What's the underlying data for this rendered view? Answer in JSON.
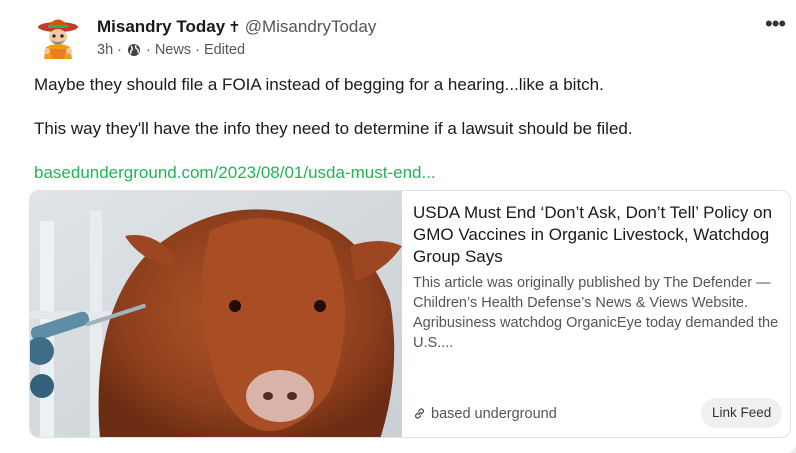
{
  "post": {
    "author_name": "Misandry Today",
    "author_badge": "✝",
    "handle": "@MisandryToday",
    "time": "3h",
    "visibility_icon": "globe-icon",
    "category": "News",
    "edited_label": "Edited",
    "more_icon": "ellipsis-icon",
    "more_label": "•••",
    "paragraphs": [
      "Maybe they should file a FOIA instead of begging for a hearing...like a bitch.",
      "This way they'll have the info they need to determine if a lawsuit should be filed."
    ],
    "link_text": "basedunderground.com/2023/08/01/usda-must-end..."
  },
  "card": {
    "title": "USDA Must End ‘Don’t Ask, Don’t Tell’ Policy on GMO Vaccines in Organic Livestock, Watchdog Group Says",
    "description": "This article was originally published by The Defender — Children’s Health Defense’s News & Views Website. Agribusiness watchdog OrganicEye today demanded the U.S....",
    "site_icon": "link-icon",
    "site_name": "based underground",
    "chip_label": "Link Feed"
  },
  "colors": {
    "link": "#22b455",
    "muted": "#555555",
    "background": "#ececec"
  }
}
